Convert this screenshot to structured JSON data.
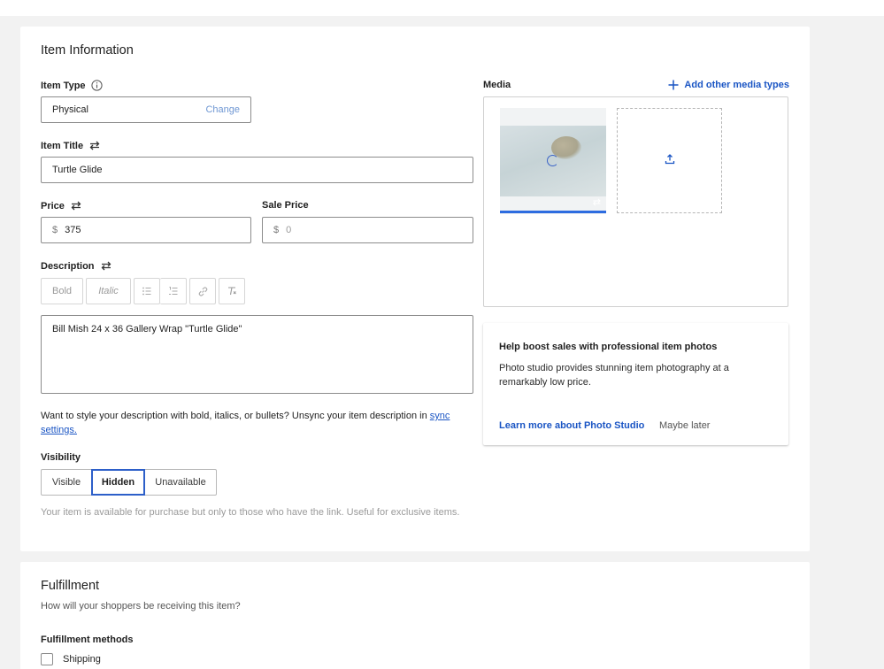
{
  "item_info": {
    "title": "Item Information",
    "item_type": {
      "label": "Item Type",
      "value": "Physical",
      "change_label": "Change"
    },
    "item_title": {
      "label": "Item Title",
      "value": "Turtle Glide"
    },
    "price": {
      "label": "Price",
      "currency": "$",
      "value": "375"
    },
    "sale_price": {
      "label": "Sale Price",
      "currency": "$",
      "placeholder": "0"
    },
    "description": {
      "label": "Description",
      "toolbar": {
        "bold": "Bold",
        "italic": "Italic"
      },
      "value": "Bill Mish 24 x 36 Gallery Wrap \"Turtle Glide\"",
      "note_prefix": "Want to style your description with bold, italics, or bullets? Unsync your item description in ",
      "note_link": "sync settings."
    },
    "visibility": {
      "label": "Visibility",
      "options": [
        "Visible",
        "Hidden",
        "Unavailable"
      ],
      "selected": "Hidden",
      "hint": "Your item is available for purchase but only to those who have the link. Useful for exclusive items."
    },
    "media": {
      "label": "Media",
      "add_label": "Add other media types",
      "upload_progress": 1.0
    },
    "promo": {
      "title": "Help boost sales with professional item photos",
      "body": "Photo studio provides stunning item photography at a remarkably low price.",
      "link": "Learn more about Photo Studio",
      "dismiss": "Maybe later"
    }
  },
  "fulfillment": {
    "title": "Fulfillment",
    "subtitle": "How will your shoppers be receiving this item?",
    "methods_label": "Fulfillment methods",
    "methods": [
      {
        "label": "Shipping",
        "checked": false
      }
    ]
  },
  "colors": {
    "accent": "#1a55c4",
    "selected_border": "#2d5fc9",
    "progress": "#2d6ce0"
  },
  "icons": [
    "info-icon",
    "sync-icon",
    "bullet-list-icon",
    "numbered-list-icon",
    "link-icon",
    "clear-format-icon",
    "plus-icon",
    "upload-icon",
    "spinner-icon"
  ]
}
